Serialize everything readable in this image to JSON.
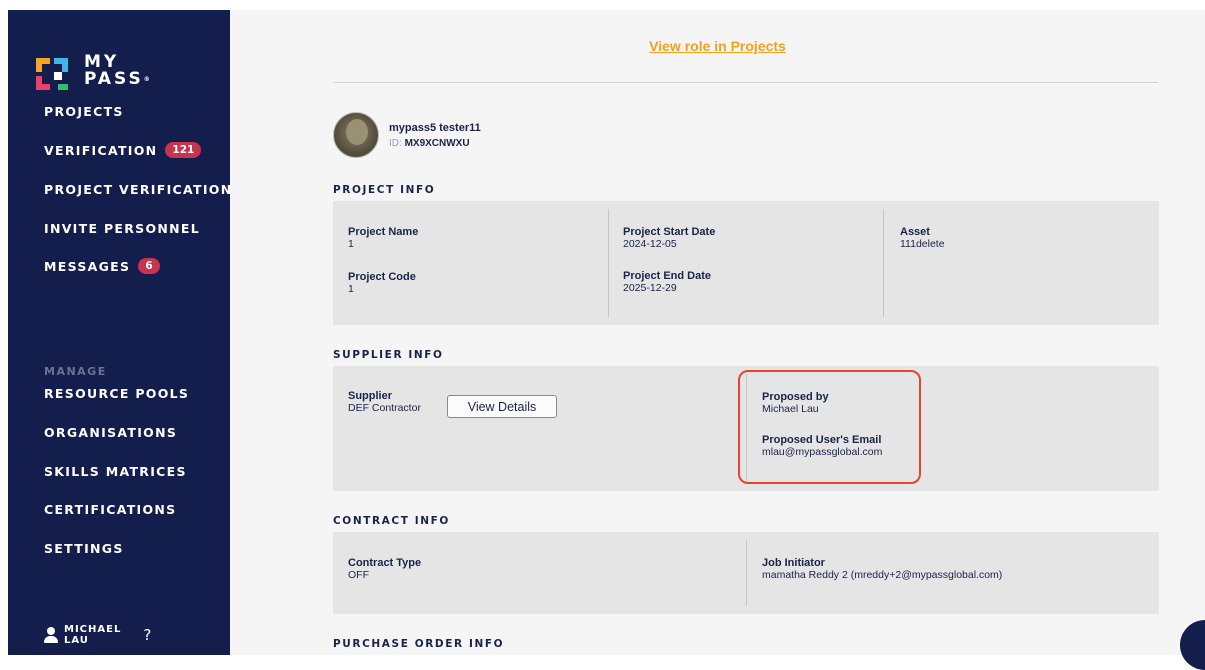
{
  "brand": {
    "line1": "MY",
    "line2": "PASS",
    "mark": "®"
  },
  "nav": {
    "projects": "PROJECTS",
    "verification": "VERIFICATION",
    "verification_badge": "121",
    "project_verification": "PROJECT VERIFICATION",
    "invite_personnel": "INVITE PERSONNEL",
    "messages": "MESSAGES",
    "messages_badge": "6",
    "manage_label": "MANAGE",
    "resource_pools": "RESOURCE POOLS",
    "organisations": "ORGANISATIONS",
    "skills_matrices": "SKILLS MATRICES",
    "certifications": "CERTIFICATIONS",
    "settings": "SETTINGS"
  },
  "user": {
    "first": "MICHAEL",
    "last": "LAU",
    "help": "?"
  },
  "main": {
    "view_role_link": "View role in Projects"
  },
  "profile": {
    "name": "mypass5 tester11",
    "id_label": "ID:",
    "id_value": "MX9XCNWXU"
  },
  "project_info": {
    "title": "PROJECT INFO",
    "project_name_label": "Project Name",
    "project_name": "1",
    "project_code_label": "Project Code",
    "project_code": "1",
    "start_label": "Project Start Date",
    "start": "2024-12-05",
    "end_label": "Project End Date",
    "end": "2025-12-29",
    "asset_label": "Asset",
    "asset": "111delete"
  },
  "supplier_info": {
    "title": "SUPPLIER INFO",
    "supplier_label": "Supplier",
    "supplier": "DEF Contractor",
    "view_details": "View Details",
    "proposed_by_label": "Proposed by",
    "proposed_by": "Michael Lau",
    "email_label": "Proposed User's Email",
    "email": "mlau@mypassglobal.com"
  },
  "contract_info": {
    "title": "CONTRACT INFO",
    "type_label": "Contract Type",
    "type": "OFF",
    "initiator_label": "Job Initiator",
    "initiator": "mamatha Reddy 2 (mreddy+2@mypassglobal.com)"
  },
  "purchase_order": {
    "title": "PURCHASE ORDER INFO"
  },
  "colors": {
    "sidebar": "#141e4c",
    "accent": "#f2a11f",
    "badge": "#c8334f",
    "highlight": "#e8442c"
  }
}
